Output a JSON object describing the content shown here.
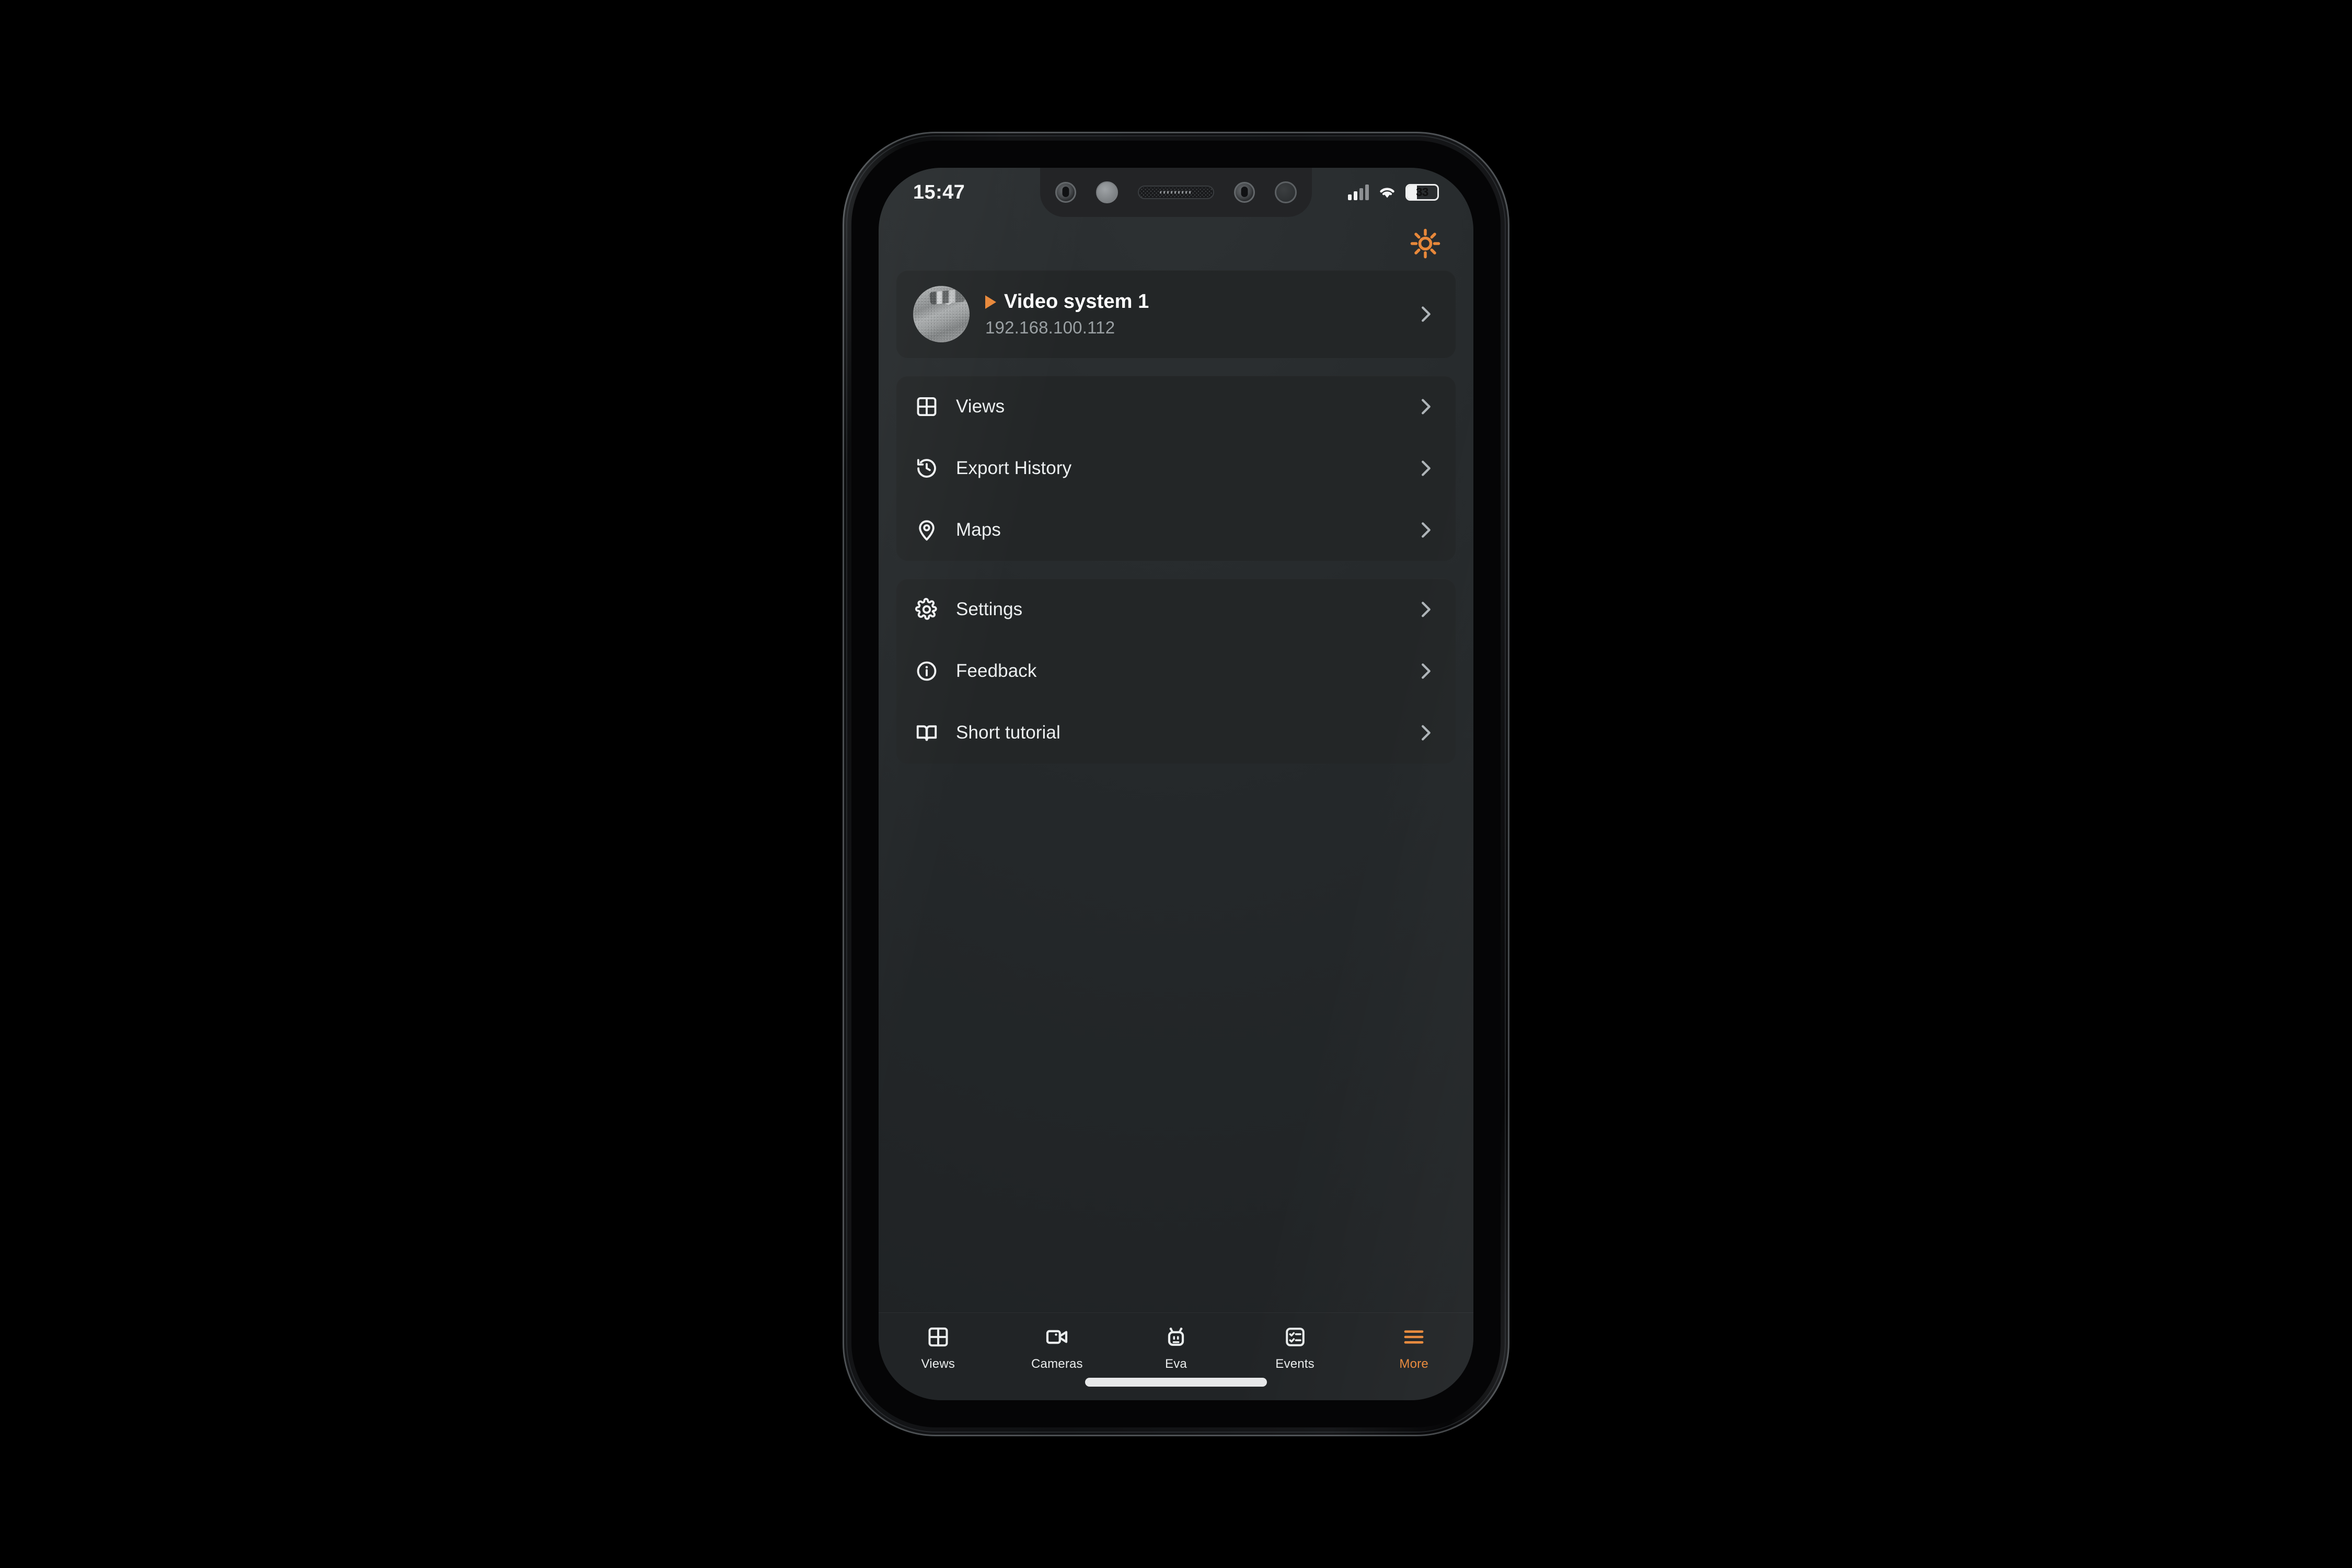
{
  "status_bar": {
    "time": "15:47",
    "battery_percent": "33",
    "battery_level": 33,
    "signal_icon": "cellular-signal-icon",
    "wifi_icon": "wifi-icon",
    "battery_icon": "battery-icon"
  },
  "top_bar": {
    "brightness_icon": "brightness-sun-icon",
    "accent_color": "#E8883A"
  },
  "system_card": {
    "avatar_icon": "camera-thumbnail-avatar",
    "play_icon": "play-triangle-icon",
    "title": "Video system 1",
    "ip_address": "192.168.100.112",
    "chevron_icon": "chevron-right-icon"
  },
  "menu_groups": [
    {
      "items": [
        {
          "label": "Views",
          "icon": "grid-views-icon",
          "chevron": "chevron-right-icon"
        },
        {
          "label": "Export History",
          "icon": "history-clock-icon",
          "chevron": "chevron-right-icon"
        },
        {
          "label": "Maps",
          "icon": "map-pin-icon",
          "chevron": "chevron-right-icon"
        }
      ]
    },
    {
      "items": [
        {
          "label": "Settings",
          "icon": "gear-icon",
          "chevron": "chevron-right-icon"
        },
        {
          "label": "Feedback",
          "icon": "info-circle-icon",
          "chevron": "chevron-right-icon"
        },
        {
          "label": "Short tutorial",
          "icon": "open-book-icon",
          "chevron": "chevron-right-icon"
        }
      ]
    }
  ],
  "tab_bar": {
    "active_color": "#E8883A",
    "inactive_color": "#E9ECEC",
    "tabs": [
      {
        "label": "Views",
        "icon": "grid-views-icon",
        "active": false
      },
      {
        "label": "Cameras",
        "icon": "video-camera-icon",
        "active": false
      },
      {
        "label": "Eva",
        "icon": "robot-face-icon",
        "active": false
      },
      {
        "label": "Events",
        "icon": "checklist-icon",
        "active": false
      },
      {
        "label": "More",
        "icon": "hamburger-menu-icon",
        "active": true
      }
    ]
  },
  "home_indicator": "home-indicator-bar"
}
